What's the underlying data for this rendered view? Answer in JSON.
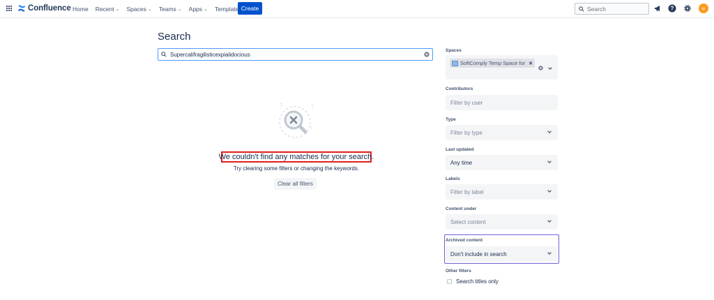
{
  "app": {
    "name": "Confluence"
  },
  "nav": {
    "items": [
      {
        "label": "Home",
        "has_dropdown": false
      },
      {
        "label": "Recent",
        "has_dropdown": true
      },
      {
        "label": "Spaces",
        "has_dropdown": true
      },
      {
        "label": "Teams",
        "has_dropdown": true
      },
      {
        "label": "Apps",
        "has_dropdown": true
      },
      {
        "label": "Templates",
        "has_dropdown": false
      }
    ],
    "create_label": "Create",
    "search_placeholder": "Search",
    "avatar_initial": "u"
  },
  "main": {
    "title": "Search",
    "query": "Supercalifragilisticexpialidocious",
    "empty_title": "We couldn't find any matches for your search.",
    "empty_subtitle": "Try clearing some filters or changing the keywords.",
    "clear_filters_label": "Clear all filters"
  },
  "filters": {
    "spaces": {
      "label": "Spaces",
      "selected_chip": "SoftComply Temp Space for"
    },
    "contributors": {
      "label": "Contributors",
      "placeholder": "Filter by user"
    },
    "type": {
      "label": "Type",
      "placeholder": "Filter by type"
    },
    "last_updated": {
      "label": "Last updated",
      "value": "Any time"
    },
    "labels": {
      "label": "Labels",
      "placeholder": "Filter by label"
    },
    "content_under": {
      "label": "Content under",
      "placeholder": "Select content"
    },
    "archived": {
      "label": "Archived content",
      "value": "Don't include in search"
    },
    "other": {
      "label": "Other filters",
      "search_titles_only": "Search titles only",
      "search_titles_checked": false
    }
  },
  "colors": {
    "brand_blue": "#0052cc",
    "focus_border": "#4c9aff",
    "highlight_red": "#e01f1f",
    "highlight_purple": "#6b63d8",
    "avatar_orange": "#ff991f"
  }
}
